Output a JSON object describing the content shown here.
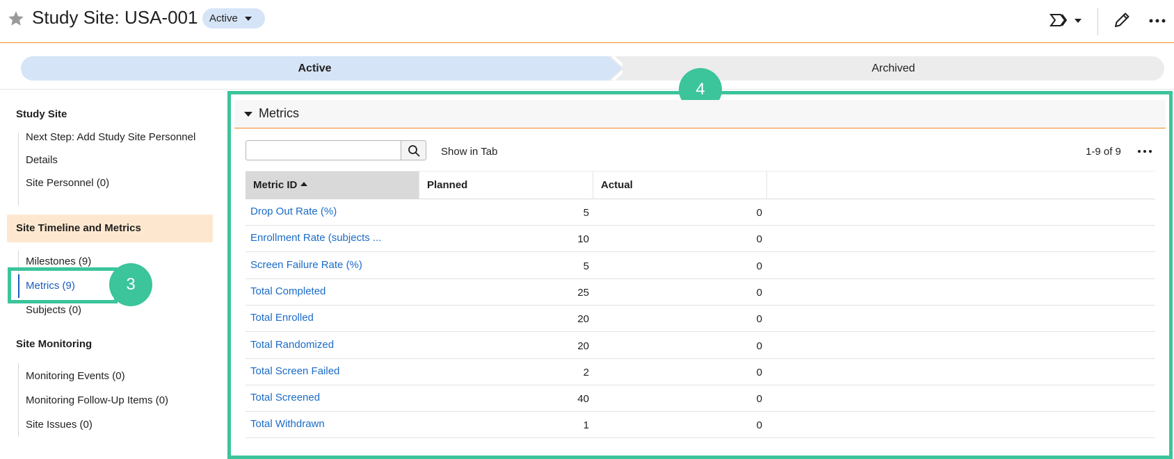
{
  "header": {
    "title": "Study Site: USA-001",
    "status": "Active"
  },
  "lifecycle": {
    "stages": [
      {
        "label": "Active",
        "current": true
      },
      {
        "label": "Archived",
        "current": false
      }
    ]
  },
  "sidebar": {
    "groups": [
      {
        "heading": "Study Site",
        "items": [
          "Next Step: Add Study Site Personnel",
          "Details",
          "Site Personnel (0)"
        ]
      },
      {
        "heading": "Site Timeline and Metrics",
        "items": [
          "Milestones (9)",
          "Metrics (9)",
          "Subjects (0)"
        ],
        "active_item": "Metrics (9)"
      },
      {
        "heading": "Site Monitoring",
        "items": [
          "Monitoring Events (0)",
          "Monitoring Follow-Up Items (0)",
          "Site Issues (0)"
        ]
      }
    ]
  },
  "annotations": {
    "sidebar_marker": "3",
    "panel_marker": "4"
  },
  "metrics": {
    "section_title": "Metrics",
    "search_placeholder": "",
    "show_in_tab": "Show in Tab",
    "pager": "1-9 of 9",
    "columns": [
      "Metric ID",
      "Planned",
      "Actual"
    ],
    "rows": [
      {
        "id": "Drop Out Rate (%)",
        "planned": "5",
        "actual": "0"
      },
      {
        "id": "Enrollment Rate (subjects ...",
        "planned": "10",
        "actual": "0"
      },
      {
        "id": "Screen Failure Rate (%)",
        "planned": "5",
        "actual": "0"
      },
      {
        "id": "Total Completed",
        "planned": "25",
        "actual": "0"
      },
      {
        "id": "Total Enrolled",
        "planned": "20",
        "actual": "0"
      },
      {
        "id": "Total Randomized",
        "planned": "20",
        "actual": "0"
      },
      {
        "id": "Total Screen Failed",
        "planned": "2",
        "actual": "0"
      },
      {
        "id": "Total Screened",
        "planned": "40",
        "actual": "0"
      },
      {
        "id": "Total Withdrawn",
        "planned": "1",
        "actual": "0"
      }
    ]
  },
  "colors": {
    "accent_orange": "#f0891f",
    "annotation_green": "#3cc49b",
    "link_blue": "#1a6bc7",
    "active_stage": "#d6e4f7"
  }
}
